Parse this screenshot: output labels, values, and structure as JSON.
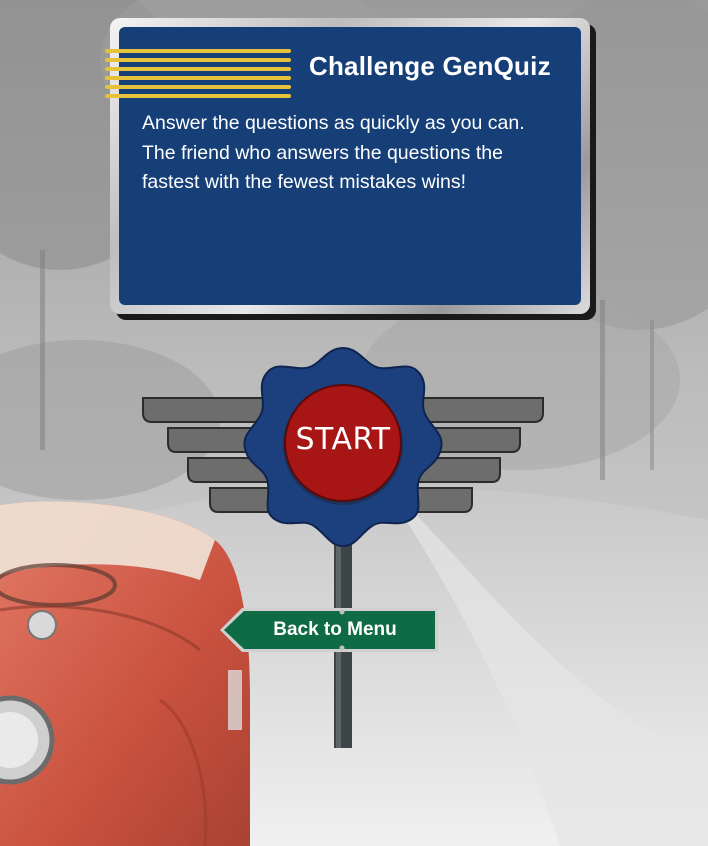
{
  "quiz": {
    "title": "Challenge GenQuiz",
    "description": "Answer the questions as quickly as you can. The friend who answers the questions the fastest with the fewest mistakes wins!"
  },
  "start": {
    "label": "START"
  },
  "back": {
    "label": "Back to Menu"
  },
  "colors": {
    "billboard_blue": "#163f78",
    "stripe_yellow": "#e6c23a",
    "start_red": "#a81515",
    "badge_blue": "#1c3f7e",
    "wing_gray": "#6d6d6d",
    "arrow_green": "#0e6b43",
    "car_red": "#d35a48"
  }
}
